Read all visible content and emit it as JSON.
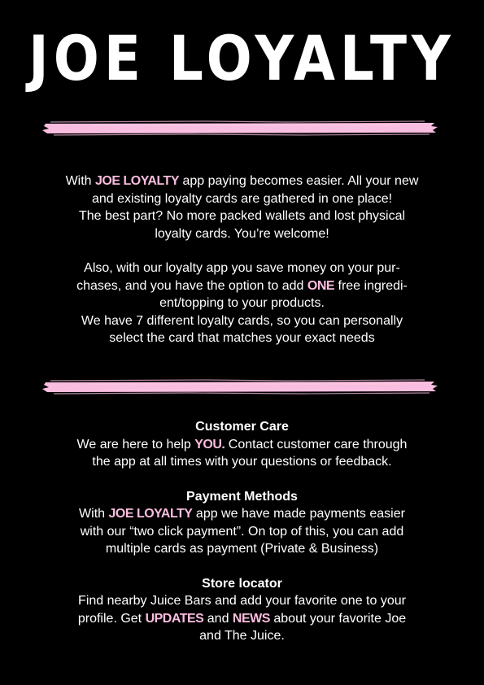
{
  "title": "JOE LOYALTY",
  "accent_color": "#f9bddf",
  "intro": {
    "p1": {
      "pre": "With ",
      "brand": "JOE LOYALTY",
      "post": " app paying becomes easier. All your new",
      "line2": "and existing loyalty cards are gathered in one place!",
      "line3": "The best part? No more packed wallets and lost physical",
      "line4": "loyalty cards. You’re welcome!"
    },
    "p2": {
      "line1": "Also, with our loyalty app you save money on your pur-",
      "line2_pre": "chases, and you have the option to add ",
      "line2_hl": "ONE",
      "line2_post": "  free ingredi-",
      "line3": "ent/topping to your products.",
      "line4": "We have 7 different loyalty cards, so you can personally",
      "line5": "select the card that matches your exact needs"
    }
  },
  "customer_care": {
    "heading": "Customer Care",
    "line1_pre": "We are here to help ",
    "line1_hl": "YOU.",
    "line1_post": " Contact customer care through",
    "line2": "the app at all times with your questions or feedback."
  },
  "payment": {
    "heading": "Payment Methods",
    "line1_pre": "With ",
    "line1_hl": "JOE LOYALTY",
    "line1_post": "  app we have made payments easier",
    "line2": "with our “two click payment”. On top of this, you can add",
    "line3": "multiple cards as payment (Private & Business)"
  },
  "store": {
    "heading": "Store locator",
    "line1": "Find nearby Juice Bars and add your favorite one to your",
    "line2_pre": "profile. Get ",
    "line2_hl1": "UPDATES",
    "line2_mid": " and ",
    "line2_hl2": "NEWS",
    "line2_post": " about your favorite Joe",
    "line3": "and The Juice."
  }
}
